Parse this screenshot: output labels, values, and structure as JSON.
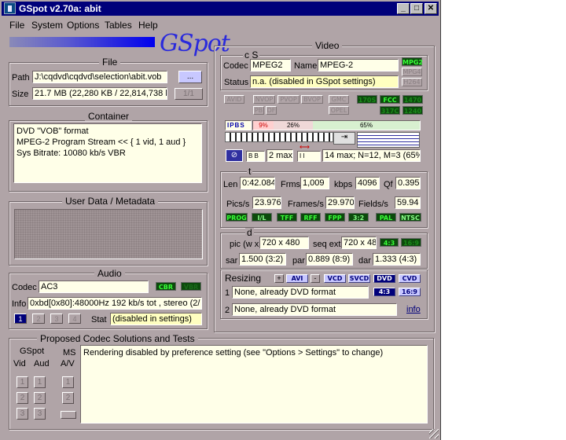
{
  "window": {
    "title": "GSpot v2.70a:  abit",
    "minimize": "_",
    "maximize": "□",
    "close": "✕"
  },
  "menu": [
    "File",
    "System",
    "Options",
    "Tables",
    "Help"
  ],
  "logo": "GSpot",
  "file": {
    "title": "File",
    "path_label": "Path",
    "path": "J:\\cqdvd\\cqdvd\\selection\\abit.vob",
    "browse": "...",
    "size_label": "Size",
    "size": "21.7 MB (22,280 KB / 22,814,738 b",
    "part": "1/1"
  },
  "container": {
    "title": "Container",
    "lines": [
      "DVD \"VOB\" format",
      "MPEG-2 Program Stream << { 1 vid, 1 aud }",
      "Sys Bitrate: 10080 kb/s VBR"
    ]
  },
  "userdata": {
    "title": "User Data / Metadata"
  },
  "audio": {
    "title": "Audio",
    "codec_label": "Codec",
    "codec": "AC3",
    "cbr": "CBR",
    "vbr": "VBR",
    "info_label": "Info",
    "info": "0xbd[0x80]:48000Hz  192 kb/s tot , stereo (2/",
    "streams": [
      "1",
      "2",
      "3",
      "4"
    ],
    "stat_label": "Stat",
    "stat": "(disabled in settings)"
  },
  "codecs": {
    "title": "Proposed Codec Solutions and Tests",
    "gspot": "GSpot",
    "vid": "Vid",
    "aud": "Aud",
    "ms": "MS",
    "av": "A/V",
    "text": "Rendering disabled by preference setting (see \"Options > Settings\" to change)",
    "nums": [
      "1",
      "2",
      "3"
    ]
  },
  "video": {
    "title": "Video",
    "cs": "c  S",
    "codec_label": "Codec",
    "codec": "MPEG2",
    "name_label": "Name",
    "name": "MPEG-2",
    "status_label": "Status",
    "status": "n.a. (disabled in GSpot settings)",
    "leds_right": [
      "MPG2",
      "MPG4",
      "H264"
    ],
    "flags_row1": [
      "AVID",
      "NVOP",
      "PVOP",
      "BVOP",
      "GMC",
      "170S",
      "FCC",
      "1470"
    ],
    "flags_row2": [
      "PB",
      "DF",
      "OPEL",
      "317C",
      "1240"
    ],
    "frame_types": "IPBS",
    "pct1": "9%",
    "pct2": "26%",
    "pct3": "65%",
    "bb": "B B",
    "max": "2 max",
    "ii": "I     I",
    "gop": "14 max; N=12, M=3 (65%",
    "t": "t",
    "len_label": "Len",
    "len": "0:42.084",
    "frms_label": "Frms",
    "frms": "1,009",
    "kbps_label": "kbps",
    "kbps": "4096",
    "qf_label": "Qf",
    "qf": "0.395",
    "pics_label": "Pics/s",
    "pics": "23.976",
    "frames_label": "Frames/s",
    "frames": "29.970",
    "fields_label": "Fields/s",
    "fields": "59.94",
    "rate_flags": [
      "PROG",
      "I/L",
      "TFF",
      "RFF",
      "FPP",
      "3:2",
      "PAL",
      "NTSC"
    ],
    "d": "d",
    "pic_label": "pic (w x",
    "pic": "720 x 480",
    "seqext_label": "seq ext",
    "seqext": "720 x 48",
    "ar1": "4:3",
    "ar2": "16:9",
    "sar_label": "sar",
    "sar": "1.500 (3:2)",
    "par_label": "par",
    "par": "0.889 (8:9)",
    "dar_label": "dar",
    "dar": "1.333 (4:3)",
    "resizing_label": "Resizing",
    "resize_btns": [
      "AVI",
      "VCD",
      "SVCD",
      "DVD",
      "CVD"
    ],
    "plus": "+",
    "minus": "-",
    "r1_label": "1",
    "r1": "None, already DVD format",
    "r2_label": "2",
    "r2": "None, already DVD format",
    "r_ar1": "4:3",
    "r_ar2": "16:9",
    "info_link": "info"
  },
  "colors": {
    "window": "#b0a4a7",
    "title": "#00007a",
    "field": "#ffffe8",
    "led_on": "#0c4a0c"
  }
}
